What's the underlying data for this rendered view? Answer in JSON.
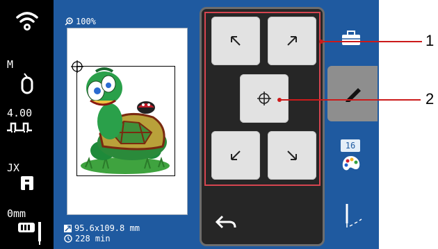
{
  "left_status": {
    "presser_foot_label": "M",
    "stitch_value": "4.00",
    "foot_type_label": "JX",
    "needle_position_label": "0mm"
  },
  "screen": {
    "zoom_label": "100%",
    "design_size": "95.6x109.8 mm",
    "design_time": "228 min"
  },
  "panel": {
    "buttons": [
      "move-up-left",
      "move-up-right",
      "center",
      "move-down-left",
      "move-down-right",
      "back"
    ]
  },
  "right_toolbar": {
    "color_count_badge": "16"
  },
  "callouts": [
    "1",
    "2"
  ],
  "colors": {
    "screen_bg": "#1f5aa0",
    "panel_bg": "#262626",
    "highlight": "#d64550",
    "callout": "#cc1a1a"
  }
}
